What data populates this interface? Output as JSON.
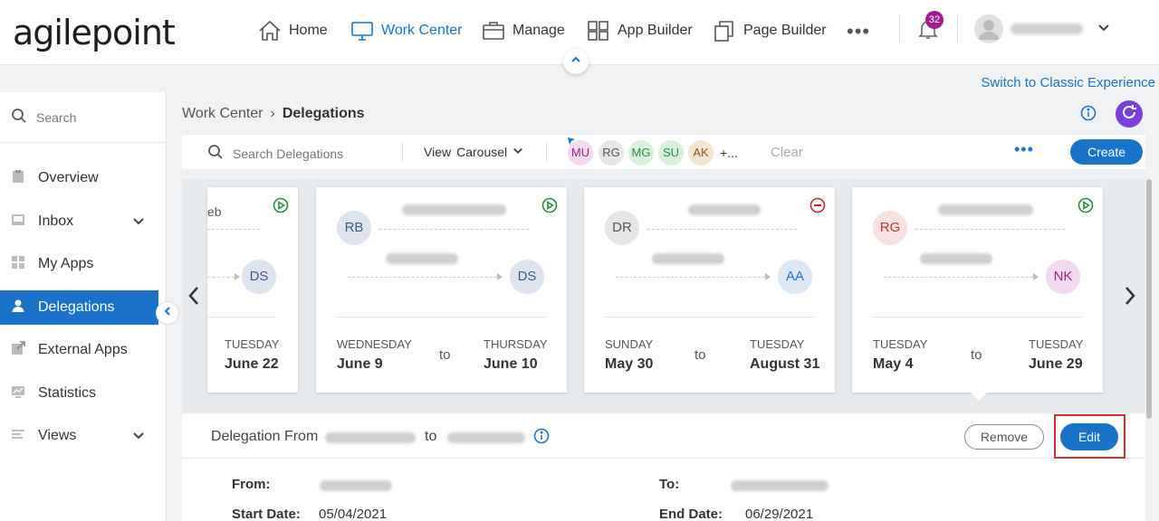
{
  "app": {
    "logo_text": "agilepoint",
    "switch_link": "Switch to Classic Experience"
  },
  "topnav": {
    "items": [
      {
        "label": "Home",
        "icon": "home-icon"
      },
      {
        "label": "Work Center",
        "icon": "monitor-icon",
        "active": true
      },
      {
        "label": "Manage",
        "icon": "briefcase-icon"
      },
      {
        "label": "App Builder",
        "icon": "grid-icon"
      },
      {
        "label": "Page Builder",
        "icon": "pages-icon"
      }
    ],
    "more": "•••",
    "notifications_count": "32"
  },
  "sidebar": {
    "search_placeholder": "Search",
    "items": [
      {
        "label": "Overview",
        "icon": "clipboard-icon"
      },
      {
        "label": "Inbox",
        "icon": "inbox-icon",
        "expandable": true
      },
      {
        "label": "My Apps",
        "icon": "apps-grid-icon"
      },
      {
        "label": "Delegations",
        "icon": "person-icon",
        "active": true
      },
      {
        "label": "External Apps",
        "icon": "external-link-icon"
      },
      {
        "label": "Statistics",
        "icon": "chart-icon"
      },
      {
        "label": "Views",
        "icon": "list-icon",
        "expandable": true
      }
    ]
  },
  "breadcrumb": {
    "parent": "Work Center",
    "separator": "›",
    "current": "Delegations"
  },
  "toolbar": {
    "search_placeholder": "Search Delegations",
    "view_label": "View",
    "view_value": "Carousel",
    "chips": [
      {
        "initials": "MU",
        "bg": "#f3d9ef",
        "fg": "#9c2784"
      },
      {
        "initials": "RG",
        "bg": "#e6e6e6",
        "fg": "#555555"
      },
      {
        "initials": "MG",
        "bg": "#d9f1dc",
        "fg": "#2e8b3d"
      },
      {
        "initials": "SU",
        "bg": "#d9f1dc",
        "fg": "#2e8b3d"
      },
      {
        "initials": "AK",
        "bg": "#f3e5d2",
        "fg": "#8a5a1c"
      }
    ],
    "chips_more": "+...",
    "clear_label": "Clear",
    "more": "•••",
    "create_label": "Create"
  },
  "cards": [
    {
      "from_text": "eb",
      "to_initials": "DS",
      "status": "active",
      "end_day": "TUESDAY",
      "end_date": "June 22"
    },
    {
      "from_initials": "RB",
      "to_initials": "DS",
      "status": "active",
      "start_day": "WEDNESDAY",
      "start_date": "June 9",
      "to_word": "to",
      "end_day": "THURSDAY",
      "end_date": "June 10"
    },
    {
      "from_initials": "DR",
      "to_initials": "AA",
      "status": "inactive",
      "start_day": "SUNDAY",
      "start_date": "May 30",
      "to_word": "to",
      "end_day": "TUESDAY",
      "end_date": "August 31"
    },
    {
      "from_initials": "RG",
      "to_initials": "NK",
      "status": "active",
      "start_day": "TUESDAY",
      "start_date": "May 4",
      "to_word": "to",
      "end_day": "TUESDAY",
      "end_date": "June 29"
    }
  ],
  "detail": {
    "title": "Delegation From",
    "to_word": "to",
    "remove_label": "Remove",
    "edit_label": "Edit",
    "from_label": "From:",
    "to_label": "To:",
    "start_label": "Start Date:",
    "start_value": "05/04/2021",
    "end_label": "End Date:",
    "end_value": "06/29/2021"
  }
}
